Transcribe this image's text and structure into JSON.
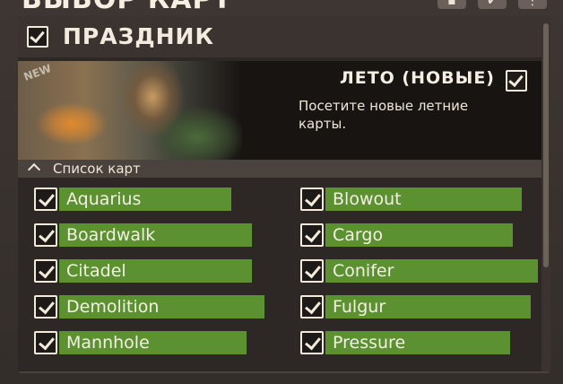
{
  "window": {
    "title": "ВЫБОР КАРТ",
    "top_buttons": [
      {
        "icon": "save-icon",
        "symbol": "▪"
      },
      {
        "icon": "check-icon",
        "symbol": "✔"
      },
      {
        "icon": "more-icon",
        "symbol": "⋮"
      }
    ]
  },
  "group": {
    "title": "ПРАЗДНИК",
    "checked": true
  },
  "banner": {
    "ribbon_text": "NEW",
    "title": "ЛЕТО (НОВЫЕ)",
    "description": "Посетите новые летние карты.",
    "checked": true
  },
  "map_list": {
    "header_label": "Список карт",
    "expanded": true,
    "accent_color": "#5b9131",
    "left_column": [
      {
        "name": "Aquarius",
        "checked": true
      },
      {
        "name": "Boardwalk",
        "checked": true
      },
      {
        "name": "Citadel",
        "checked": true
      },
      {
        "name": "Demolition",
        "checked": true
      },
      {
        "name": "Mannhole",
        "checked": true
      }
    ],
    "right_column": [
      {
        "name": "Blowout",
        "checked": true
      },
      {
        "name": "Cargo",
        "checked": true
      },
      {
        "name": "Conifer",
        "checked": true
      },
      {
        "name": "Fulgur",
        "checked": true
      },
      {
        "name": "Pressure",
        "checked": true
      }
    ]
  }
}
